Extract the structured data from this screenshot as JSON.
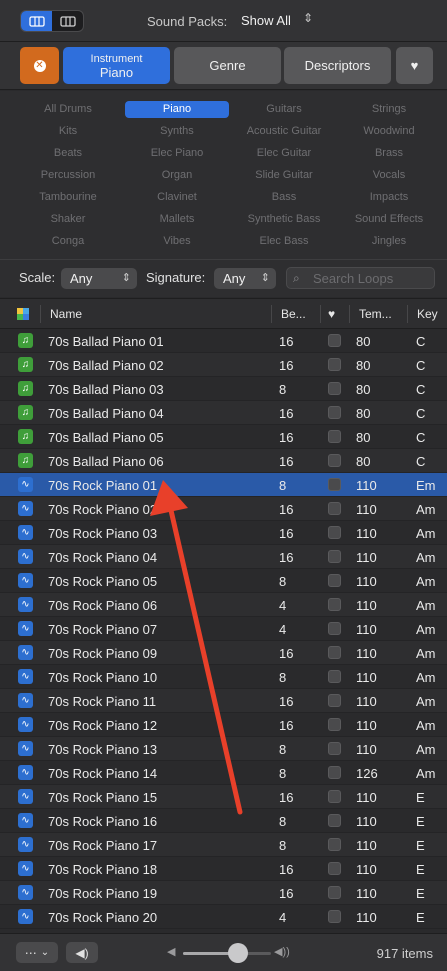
{
  "topbar": {
    "view_modes": [
      "list-view",
      "column-view"
    ],
    "sound_packs_label": "Sound Packs:",
    "sound_packs_value": "Show All",
    "chevron": "⌃⌄"
  },
  "tabs": {
    "reset_icon": "✕",
    "instrument_small": "Instrument",
    "instrument_value": "Piano",
    "genre": "Genre",
    "descriptors": "Descriptors",
    "favorites_icon": "♥"
  },
  "keywords": [
    [
      "All Drums",
      "Piano",
      "Guitars",
      "Strings"
    ],
    [
      "Kits",
      "Synths",
      "Acoustic Guitar",
      "Woodwind"
    ],
    [
      "Beats",
      "Elec Piano",
      "Elec Guitar",
      "Brass"
    ],
    [
      "Percussion",
      "Organ",
      "Slide Guitar",
      "Vocals"
    ],
    [
      "Tambourine",
      "Clavinet",
      "Bass",
      "Impacts"
    ],
    [
      "Shaker",
      "Mallets",
      "Synthetic Bass",
      "Sound Effects"
    ],
    [
      "Conga",
      "Vibes",
      "Elec Bass",
      "Jingles"
    ]
  ],
  "selected_keyword": "Piano",
  "filters": {
    "scale_label": "Scale:",
    "scale_value": "Any",
    "signature_label": "Signature:",
    "signature_value": "Any",
    "search_placeholder": "Search Loops"
  },
  "columns": {
    "name": "Name",
    "beats": "Be...",
    "favorite_icon": "♥",
    "tempo": "Tem...",
    "key": "Key"
  },
  "loops": [
    {
      "name": "70s Ballad Piano 01",
      "beats": "16",
      "tempo": "80",
      "key": "C",
      "type": "midi"
    },
    {
      "name": "70s Ballad Piano 02",
      "beats": "16",
      "tempo": "80",
      "key": "C",
      "type": "midi"
    },
    {
      "name": "70s Ballad Piano 03",
      "beats": "8",
      "tempo": "80",
      "key": "C",
      "type": "midi"
    },
    {
      "name": "70s Ballad Piano 04",
      "beats": "16",
      "tempo": "80",
      "key": "C",
      "type": "midi"
    },
    {
      "name": "70s Ballad Piano 05",
      "beats": "16",
      "tempo": "80",
      "key": "C",
      "type": "midi"
    },
    {
      "name": "70s Ballad Piano 06",
      "beats": "16",
      "tempo": "80",
      "key": "C",
      "type": "midi"
    },
    {
      "name": "70s Rock Piano 01",
      "beats": "8",
      "tempo": "110",
      "key": "Em",
      "type": "audio",
      "selected": true
    },
    {
      "name": "70s Rock Piano 02",
      "beats": "16",
      "tempo": "110",
      "key": "Am",
      "type": "audio"
    },
    {
      "name": "70s Rock Piano 03",
      "beats": "16",
      "tempo": "110",
      "key": "Am",
      "type": "audio"
    },
    {
      "name": "70s Rock Piano 04",
      "beats": "16",
      "tempo": "110",
      "key": "Am",
      "type": "audio"
    },
    {
      "name": "70s Rock Piano 05",
      "beats": "8",
      "tempo": "110",
      "key": "Am",
      "type": "audio"
    },
    {
      "name": "70s Rock Piano 06",
      "beats": "4",
      "tempo": "110",
      "key": "Am",
      "type": "audio"
    },
    {
      "name": "70s Rock Piano 07",
      "beats": "4",
      "tempo": "110",
      "key": "Am",
      "type": "audio"
    },
    {
      "name": "70s Rock Piano 09",
      "beats": "16",
      "tempo": "110",
      "key": "Am",
      "type": "audio"
    },
    {
      "name": "70s Rock Piano 10",
      "beats": "8",
      "tempo": "110",
      "key": "Am",
      "type": "audio"
    },
    {
      "name": "70s Rock Piano 11",
      "beats": "16",
      "tempo": "110",
      "key": "Am",
      "type": "audio"
    },
    {
      "name": "70s Rock Piano 12",
      "beats": "16",
      "tempo": "110",
      "key": "Am",
      "type": "audio"
    },
    {
      "name": "70s Rock Piano 13",
      "beats": "8",
      "tempo": "110",
      "key": "Am",
      "type": "audio"
    },
    {
      "name": "70s Rock Piano 14",
      "beats": "8",
      "tempo": "126",
      "key": "Am",
      "type": "audio"
    },
    {
      "name": "70s Rock Piano 15",
      "beats": "16",
      "tempo": "110",
      "key": "E",
      "type": "audio"
    },
    {
      "name": "70s Rock Piano 16",
      "beats": "8",
      "tempo": "110",
      "key": "E",
      "type": "audio"
    },
    {
      "name": "70s Rock Piano 17",
      "beats": "8",
      "tempo": "110",
      "key": "E",
      "type": "audio"
    },
    {
      "name": "70s Rock Piano 18",
      "beats": "16",
      "tempo": "110",
      "key": "E",
      "type": "audio"
    },
    {
      "name": "70s Rock Piano 19",
      "beats": "16",
      "tempo": "110",
      "key": "E",
      "type": "audio"
    },
    {
      "name": "70s Rock Piano 20",
      "beats": "4",
      "tempo": "110",
      "key": "E",
      "type": "audio"
    }
  ],
  "bottombar": {
    "more_icon": "⋯",
    "more_chevron": "⌄",
    "preview_icon": "🔈",
    "volume_level": 0.62,
    "item_count": "917 items"
  },
  "colors": {
    "accent": "#2f6fdc",
    "reset_orange": "#d26a1e",
    "midi_green": "#3f9e3a",
    "annotation_arrow": "#e8402a"
  }
}
